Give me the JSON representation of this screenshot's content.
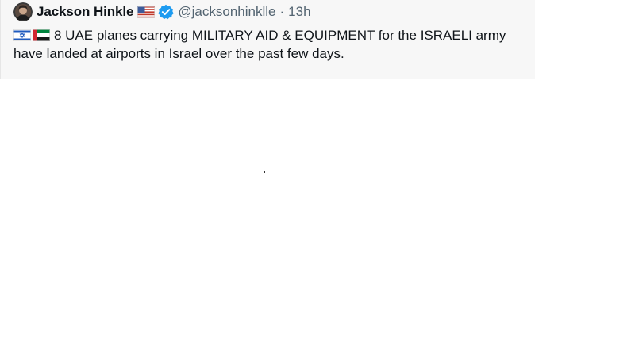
{
  "tweet": {
    "author": {
      "display_name": "Jackson Hinkle",
      "handle": "@jacksonhinklle",
      "name_flag_icon": "us-flag-icon",
      "verified_icon": "verified-badge-icon"
    },
    "separator": "·",
    "time": "13h",
    "body": {
      "flag_icons": [
        "israel-flag-icon",
        "uae-flag-icon"
      ],
      "text": "8 UAE planes carrying MILITARY AID & EQUIPMENT for the ISRAELI army have landed at airports in Israel over the past few days."
    }
  },
  "colors": {
    "card_background": "#f7f7f7",
    "text_primary": "#0f1419",
    "text_secondary": "#536471",
    "verified_blue": "#1d9bf0"
  }
}
